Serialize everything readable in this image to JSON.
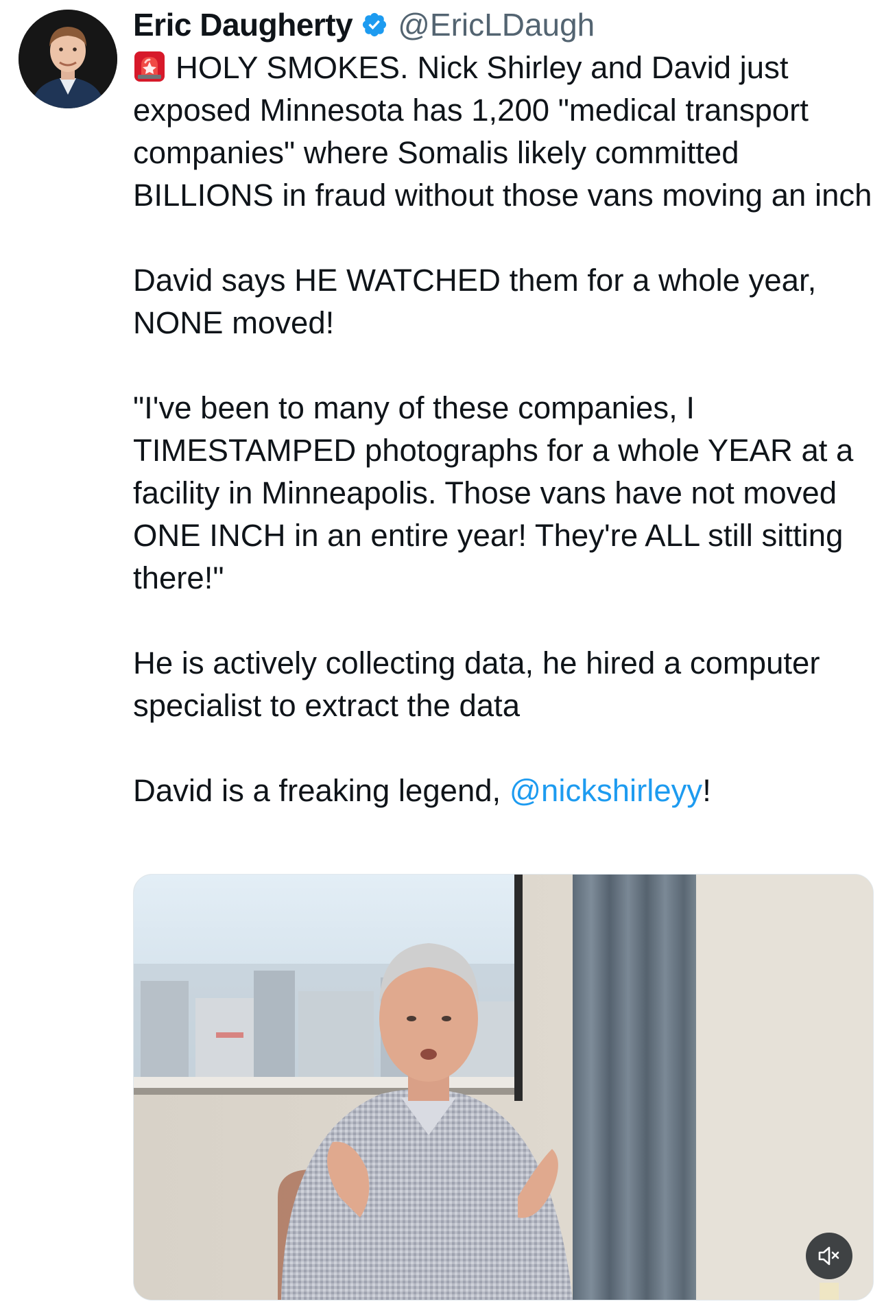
{
  "author": {
    "display_name": "Eric Daugherty",
    "handle": "@EricLDaugh",
    "verified": true,
    "verified_color": "#1d9bf0",
    "avatar_icon": "profile-photo"
  },
  "tweet": {
    "lead_icon": "police-light-icon",
    "paragraph_1": "HOLY SMOKES. Nick Shirley and David just exposed Minnesota has 1,200 \"medical transport companies\" where Somalis likely committed BILLIONS in fraud without those vans moving an inch",
    "paragraph_2": "David says HE WATCHED them for a whole year, NONE moved!",
    "paragraph_3": "\"I've been to many of these companies, I TIMESTAMPED photographs for a whole YEAR at a facility in Minneapolis. Those vans have not moved ONE INCH in an entire year! They're ALL still sitting there!\"",
    "paragraph_4": "He is actively collecting data, he hired a computer specialist to extract the data",
    "paragraph_5_text": "David is a freaking legend, ",
    "paragraph_5_mention": "@nickshirleyy",
    "paragraph_5_suffix": "!",
    "mention_color": "#1d9bf0"
  },
  "media": {
    "type": "video",
    "mute_icon": "speaker-muted-icon"
  }
}
